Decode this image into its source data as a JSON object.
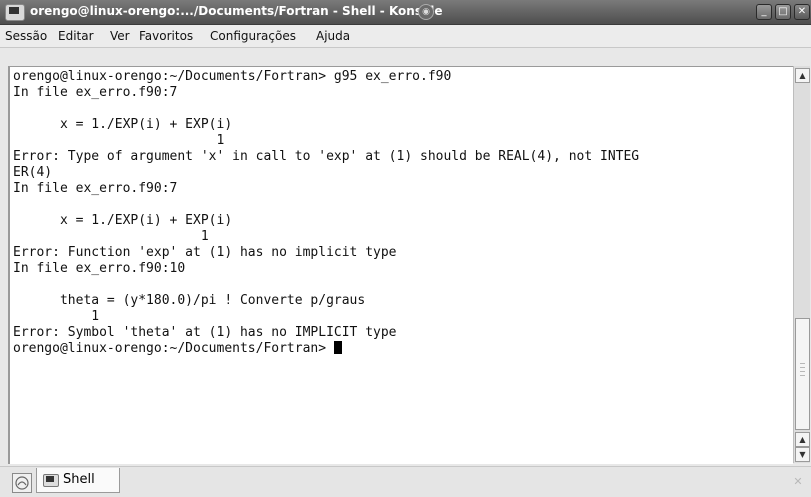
{
  "window": {
    "title": "orengo@linux-orengo:.../Documents/Fortran - Shell - Konsole",
    "pin_glyph": "◉",
    "minimize_glyph": "_",
    "maximize_glyph": "□",
    "close_glyph": "✕"
  },
  "menu": {
    "items": [
      "Sessão",
      "Editar",
      "Ver",
      "Favoritos",
      "Configurações",
      "Ajuda"
    ]
  },
  "terminal": {
    "lines": [
      "orengo@linux-orengo:~/Documents/Fortran> g95 ex_erro.f90",
      "In file ex_erro.f90:7",
      "",
      "      x = 1./EXP(i) + EXP(i)",
      "                          1",
      "Error: Type of argument 'x' in call to 'exp' at (1) should be REAL(4), not INTEG",
      "ER(4)",
      "In file ex_erro.f90:7",
      "",
      "      x = 1./EXP(i) + EXP(i)",
      "                        1",
      "Error: Function 'exp' at (1) has no implicit type",
      "In file ex_erro.f90:10",
      "",
      "      theta = (y*180.0)/pi ! Converte p/graus",
      "          1",
      "Error: Symbol 'theta' at (1) has no IMPLICIT type",
      "orengo@linux-orengo:~/Documents/Fortran> "
    ]
  },
  "scrollbar": {
    "up_glyph": "▲",
    "down_glyph": "▼"
  },
  "tabs": {
    "items": [
      {
        "label": "Shell",
        "icon": "terminal-icon"
      }
    ],
    "new_tab_icon": "new-session-icon",
    "close_glyph": "✕"
  }
}
